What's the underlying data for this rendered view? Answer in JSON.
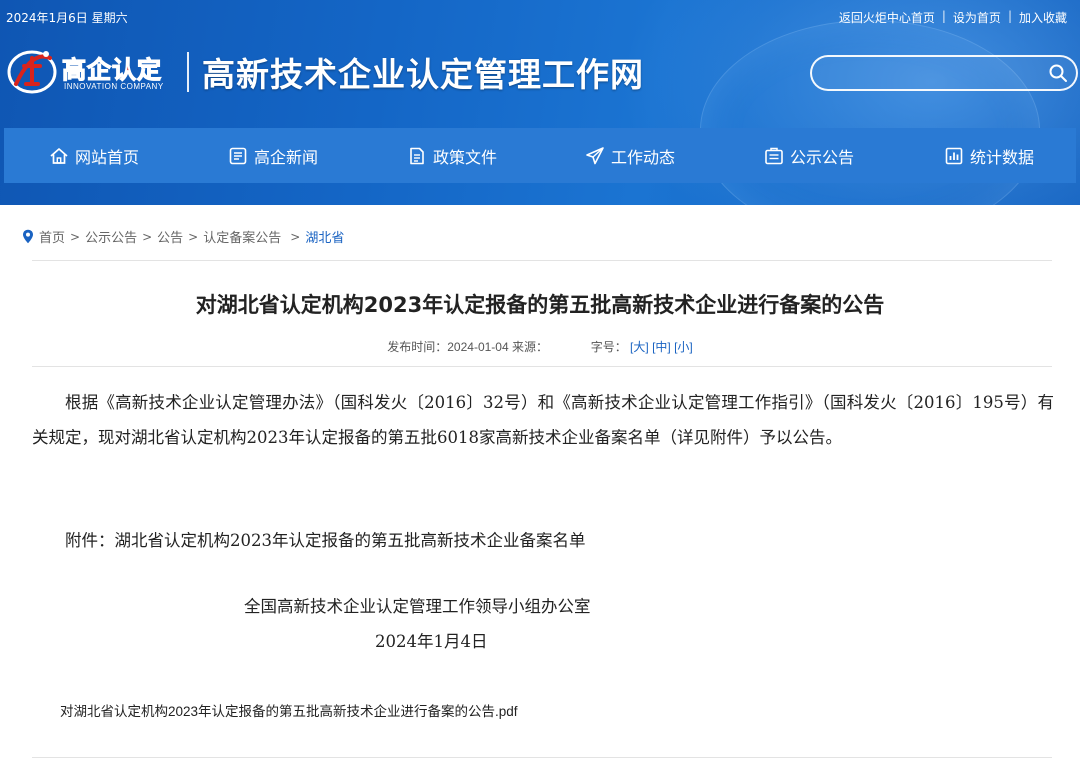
{
  "topbar": {
    "date": "2024年1月6日 星期六",
    "links": [
      "返回火炬中心首页",
      "设为首页",
      "加入收藏"
    ],
    "separator": "|"
  },
  "logo": {
    "brand": "高企认定",
    "brand_en": "INNOVATION COMPANY"
  },
  "site_title": "高新技术企业认定管理工作网",
  "search": {
    "placeholder": "",
    "icon": "search-icon"
  },
  "nav": {
    "items": [
      {
        "label": "网站首页",
        "icon": "home-icon"
      },
      {
        "label": "高企新闻",
        "icon": "news-icon"
      },
      {
        "label": "政策文件",
        "icon": "document-icon"
      },
      {
        "label": "工作动态",
        "icon": "paper-plane-icon"
      },
      {
        "label": "公示公告",
        "icon": "announcement-icon"
      },
      {
        "label": "统计数据",
        "icon": "chart-icon"
      }
    ]
  },
  "breadcrumb": {
    "items": [
      "首页",
      "公示公告",
      "公告",
      "认定备案公告"
    ],
    "current": "湖北省",
    "separator": ">"
  },
  "article": {
    "title": "对湖北省认定机构2023年认定报备的第五批高新技术企业进行备案的公告",
    "meta": {
      "publish_label": "发布时间：",
      "publish_date": "2024-01-04",
      "source_label": "来源：",
      "font_size_label": "字号：",
      "font_sizes": [
        "[大]",
        "[中]",
        "[小]"
      ]
    },
    "paragraph1": "根据《高新技术企业认定管理办法》（国科发火〔2016〕32号）和《高新技术企业认定管理工作指引》（国科发火〔2016〕195号）有关规定，现对湖北省认定机构2023年认定报备的第五批6018家高新技术企业备案名单（详见附件）予以公告。",
    "attachment_text": "附件：湖北省认定机构2023年认定报备的第五批高新技术企业备案名单",
    "signature_org": "全国高新技术企业认定管理工作领导小组办公室",
    "signature_date": "2024年1月4日",
    "attachment_link": "对湖北省认定机构2023年认定报备的第五批高新技术企业进行备案的公告.pdf"
  },
  "colors": {
    "header_blue": "#1466c6",
    "nav_blue": "#2a7ad4",
    "link_blue": "#1a63c2",
    "logo_red": "#d8231c"
  }
}
